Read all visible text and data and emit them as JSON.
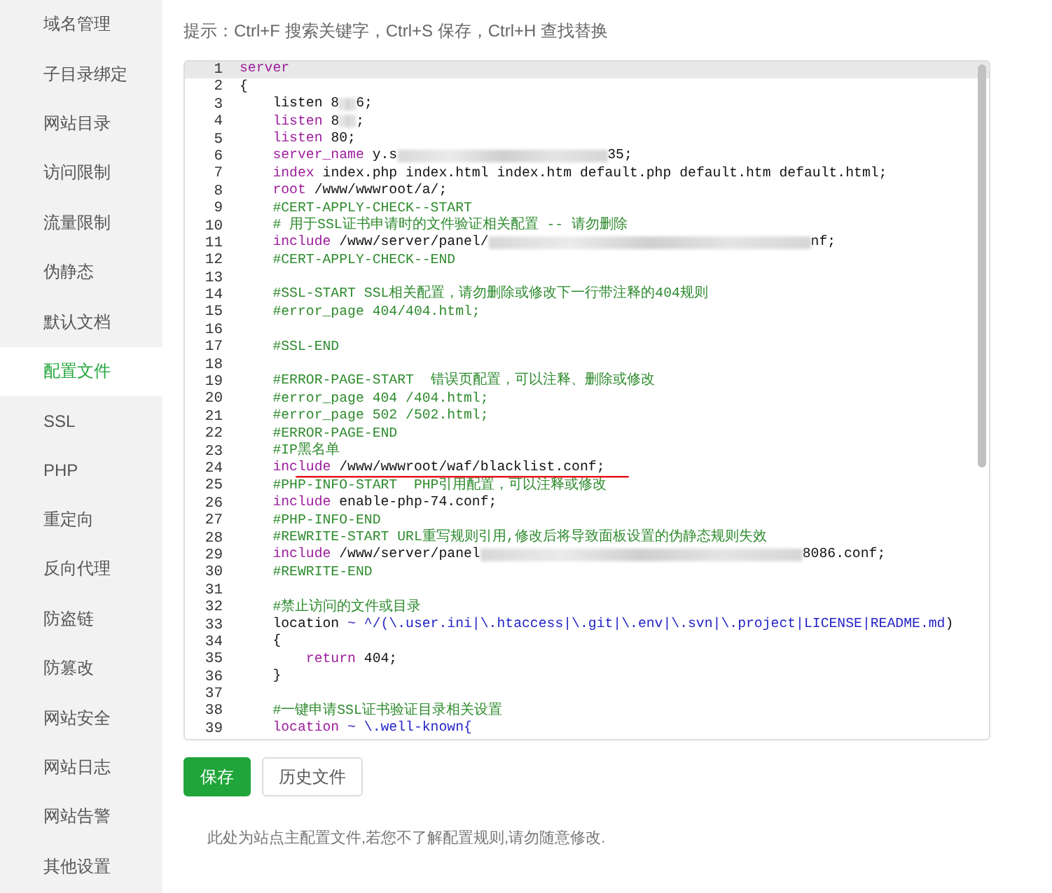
{
  "sidebar": {
    "items": [
      {
        "label": "域名管理",
        "selected": false
      },
      {
        "label": "子目录绑定",
        "selected": false
      },
      {
        "label": "网站目录",
        "selected": false
      },
      {
        "label": "访问限制",
        "selected": false
      },
      {
        "label": "流量限制",
        "selected": false
      },
      {
        "label": "伪静态",
        "selected": false
      },
      {
        "label": "默认文档",
        "selected": false
      },
      {
        "label": "配置文件",
        "selected": true
      },
      {
        "label": "SSL",
        "selected": false
      },
      {
        "label": "PHP",
        "selected": false
      },
      {
        "label": "重定向",
        "selected": false
      },
      {
        "label": "反向代理",
        "selected": false
      },
      {
        "label": "防盗链",
        "selected": false
      },
      {
        "label": "防篡改",
        "selected": false
      },
      {
        "label": "网站安全",
        "selected": false
      },
      {
        "label": "网站日志",
        "selected": false
      },
      {
        "label": "网站告警",
        "selected": false
      },
      {
        "label": "其他设置",
        "selected": false
      }
    ]
  },
  "hint": "提示：Ctrl+F 搜索关键字，Ctrl+S 保存，Ctrl+H 查找替换",
  "editor": {
    "lines": [
      {
        "number": "1",
        "selected": true,
        "parts": [
          {
            "kind": "keyword",
            "text": "server"
          }
        ]
      },
      {
        "number": "2",
        "selected": false,
        "parts": [
          {
            "kind": "plain",
            "text": "{"
          }
        ]
      },
      {
        "number": "3",
        "selected": false,
        "parts": [
          {
            "kind": "plain",
            "text": "    listen 8"
          },
          {
            "kind": "blur_short"
          },
          {
            "kind": "plain",
            "text": "6;"
          }
        ]
      },
      {
        "number": "4",
        "selected": false,
        "parts": [
          {
            "kind": "keyword",
            "text": "    listen"
          },
          {
            "kind": "plain",
            "text": " 8"
          },
          {
            "kind": "blur_short"
          },
          {
            "kind": "plain",
            "text": ";"
          }
        ]
      },
      {
        "number": "5",
        "selected": false,
        "parts": [
          {
            "kind": "keyword",
            "text": "    listen"
          },
          {
            "kind": "plain",
            "text": " 80;"
          }
        ]
      },
      {
        "number": "6",
        "selected": false,
        "parts": [
          {
            "kind": "keyword",
            "text": "    server_name"
          },
          {
            "kind": "plain",
            "text": " y.s"
          },
          {
            "kind": "blur_long"
          },
          {
            "kind": "plain",
            "text": "35;"
          }
        ]
      },
      {
        "number": "7",
        "selected": false,
        "parts": [
          {
            "kind": "keyword",
            "text": "    index"
          },
          {
            "kind": "plain",
            "text": " index.php index.html index.htm default.php default.htm default.html;"
          }
        ]
      },
      {
        "number": "8",
        "selected": false,
        "parts": [
          {
            "kind": "keyword",
            "text": "    root"
          },
          {
            "kind": "plain",
            "text": " /www/wwwroot/a/;"
          }
        ]
      },
      {
        "number": "9",
        "selected": false,
        "parts": [
          {
            "kind": "comment",
            "text": "    #CERT-APPLY-CHECK--START"
          }
        ]
      },
      {
        "number": "10",
        "selected": false,
        "parts": [
          {
            "kind": "comment",
            "text": "    # 用于SSL证书申请时的文件验证相关配置 -- 请勿删除"
          }
        ]
      },
      {
        "number": "11",
        "selected": false,
        "parts": [
          {
            "kind": "keyword",
            "text": "    include"
          },
          {
            "kind": "plain",
            "text": " /www/server/panel/"
          },
          {
            "kind": "blur_xlong"
          },
          {
            "kind": "plain",
            "text": "nf;"
          }
        ]
      },
      {
        "number": "12",
        "selected": false,
        "parts": [
          {
            "kind": "comment",
            "text": "    #CERT-APPLY-CHECK--END"
          }
        ]
      },
      {
        "number": "13",
        "selected": false
      },
      {
        "number": "14",
        "selected": false,
        "parts": [
          {
            "kind": "comment",
            "text": "    #SSL-START SSL相关配置，请勿删除或修改下一行带注释的404规则"
          }
        ]
      },
      {
        "number": "15",
        "selected": false,
        "parts": [
          {
            "kind": "comment",
            "text": "    #error_page 404/404.html;"
          }
        ]
      },
      {
        "number": "16",
        "selected": false
      },
      {
        "number": "17",
        "selected": false,
        "parts": [
          {
            "kind": "comment",
            "text": "    #SSL-END"
          }
        ]
      },
      {
        "number": "18",
        "selected": false
      },
      {
        "number": "19",
        "selected": false,
        "parts": [
          {
            "kind": "comment",
            "text": "    #ERROR-PAGE-START  错误页配置，可以注释、删除或修改"
          }
        ]
      },
      {
        "number": "20",
        "selected": false,
        "parts": [
          {
            "kind": "comment",
            "text": "    #error_page 404 /404.html;"
          }
        ]
      },
      {
        "number": "21",
        "selected": false,
        "parts": [
          {
            "kind": "comment",
            "text": "    #error_page 502 /502.html;"
          }
        ]
      },
      {
        "number": "22",
        "selected": false,
        "parts": [
          {
            "kind": "comment",
            "text": "    #ERROR-PAGE-END"
          }
        ]
      },
      {
        "number": "23",
        "selected": false,
        "parts": [
          {
            "kind": "comment",
            "text": "    #IP黑名单"
          }
        ]
      },
      {
        "number": "24",
        "selected": false,
        "parts": [
          {
            "kind": "keyword",
            "text": "    include"
          },
          {
            "kind": "plain",
            "text": " /www/wwwroot/waf/blacklist.conf;"
          }
        ]
      },
      {
        "number": "25",
        "selected": false,
        "parts": [
          {
            "kind": "comment",
            "text": "    #PHP-INFO-START  PHP引用配置，可以注释或修改"
          }
        ]
      },
      {
        "number": "26",
        "selected": false,
        "parts": [
          {
            "kind": "keyword",
            "text": "    include"
          },
          {
            "kind": "plain",
            "text": " enable-php-74.conf;"
          }
        ]
      },
      {
        "number": "27",
        "selected": false,
        "parts": [
          {
            "kind": "comment",
            "text": "    #PHP-INFO-END"
          }
        ]
      },
      {
        "number": "28",
        "selected": false,
        "parts": [
          {
            "kind": "comment",
            "text": "    #REWRITE-START URL重写规则引用,修改后将导致面板设置的伪静态规则失效"
          }
        ]
      },
      {
        "number": "29",
        "selected": false,
        "parts": [
          {
            "kind": "keyword",
            "text": "    include"
          },
          {
            "kind": "plain",
            "text": " /www/server/panel"
          },
          {
            "kind": "blur_xlong"
          },
          {
            "kind": "plain",
            "text": "8086.conf;"
          }
        ]
      },
      {
        "number": "30",
        "selected": false,
        "parts": [
          {
            "kind": "comment",
            "text": "    #REWRITE-END"
          }
        ]
      },
      {
        "number": "31",
        "selected": false
      },
      {
        "number": "32",
        "selected": false,
        "parts": [
          {
            "kind": "comment",
            "text": "    #禁止访问的文件或目录"
          }
        ]
      },
      {
        "number": "33",
        "selected": false,
        "parts": [
          {
            "kind": "plain",
            "text": "    location "
          },
          {
            "kind": "regex",
            "text": "~ ^/(\\.user.ini|\\.htaccess|\\.git|\\.env|\\.svn|\\.project|LICENSE|README.md"
          },
          {
            "kind": "plain",
            "text": ")"
          }
        ]
      },
      {
        "number": "34",
        "selected": false,
        "parts": [
          {
            "kind": "plain",
            "text": "    {"
          }
        ]
      },
      {
        "number": "35",
        "selected": false,
        "parts": [
          {
            "kind": "keyword",
            "text": "        return"
          },
          {
            "kind": "plain",
            "text": " 404;"
          }
        ]
      },
      {
        "number": "36",
        "selected": false,
        "parts": [
          {
            "kind": "plain",
            "text": "    }"
          }
        ]
      },
      {
        "number": "37",
        "selected": false
      },
      {
        "number": "38",
        "selected": false,
        "parts": [
          {
            "kind": "comment",
            "text": "    #一键申请SSL证书验证目录相关设置"
          }
        ]
      },
      {
        "number": "39",
        "selected": false,
        "parts": [
          {
            "kind": "keyword",
            "text": "    location"
          },
          {
            "kind": "regex",
            "text": " ~ \\.well-known{"
          }
        ]
      }
    ]
  },
  "buttons": [
    {
      "label": "保存",
      "kind": "primary"
    },
    {
      "label": "历史文件",
      "kind": "secondary"
    }
  ],
  "note": "此处为站点主配置文件,若您不了解配置规则,请勿随意修改."
}
